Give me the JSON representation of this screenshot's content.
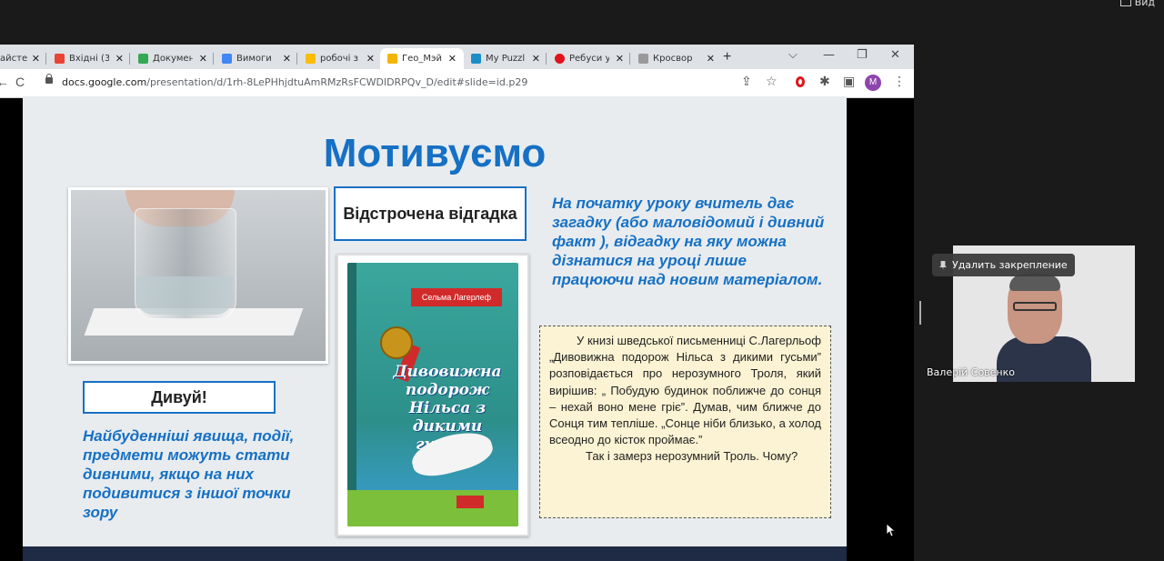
{
  "top": {
    "view_label": "Вид"
  },
  "tabs": [
    {
      "title": "айстер",
      "favicon_color": "#1a73e8"
    },
    {
      "title": "Вхідні (3",
      "favicon_color": "#ea4335"
    },
    {
      "title": "Докумен",
      "favicon_color": "#34a853"
    },
    {
      "title": "Вимоги",
      "favicon_color": "#4285f4"
    },
    {
      "title": "робочі з",
      "favicon_color": "#fbbc04"
    },
    {
      "title": "Гео_Мэй",
      "favicon_color": "#f4b400",
      "active": true
    },
    {
      "title": "My Puzzl",
      "favicon_color": "#1b8ec8"
    },
    {
      "title": "Ребуси у",
      "favicon_color": "#e0131a"
    },
    {
      "title": "Кросвор",
      "favicon_color": "#999999"
    }
  ],
  "tab_close": "✕",
  "new_tab": "+",
  "window": {
    "minimize": "—",
    "restore": "❐",
    "close": "✕",
    "dropdown": "⌵"
  },
  "address": {
    "url_host": "docs.google.com",
    "url_path": "/presentation/d/1rh-8LePHhjdtuAmRMzRsFCWDlDRPQv_D/edit#slide=id.p29",
    "back": "←",
    "reload": "C"
  },
  "toolbar_icons": {
    "share": "⇪",
    "star": "☆",
    "extensions": "✱",
    "sidebar": "▣",
    "menu": "⋮",
    "profile_initial": "M"
  },
  "slide": {
    "title": "Мотивуємо",
    "delayed_answer": "Відстрочена відгадка",
    "wonder": "Дивуй!",
    "top_right_text": "На початку уроку вчитель дає загадку (або маловідомий і дивний факт ), відгадку на яку можна дізнатися на уроці лише працюючи над новим матеріалом.",
    "bottom_left_text": "Найбуденніші явища, події, предмети можуть стати дивними, якщо на них подивитися з іншої точки зору",
    "book": {
      "author": "Сельма Лагерлеф",
      "title": "Дивовижна подорож Нільса з дикими гусьми"
    },
    "quote": {
      "p1": "У книзі шведської письменниці С.Лагерльоф „Дивовижна подорож Нільса з дикими гусьми” розповідається про нерозумного Троля, який вирішив: „ Побудую будинок поближче до сонця – нехай воно мене гріє”. Думав, чим ближче до Сонця тим тепліше. „Сонце ніби близько, а холод всеодно до кісток проймає.”",
      "p2": "Так і замерз нерозумний Троль. Чому?"
    }
  },
  "meeting": {
    "unpin_label": "Удалить закрепление",
    "participant_name": "Валерій Совенко"
  }
}
